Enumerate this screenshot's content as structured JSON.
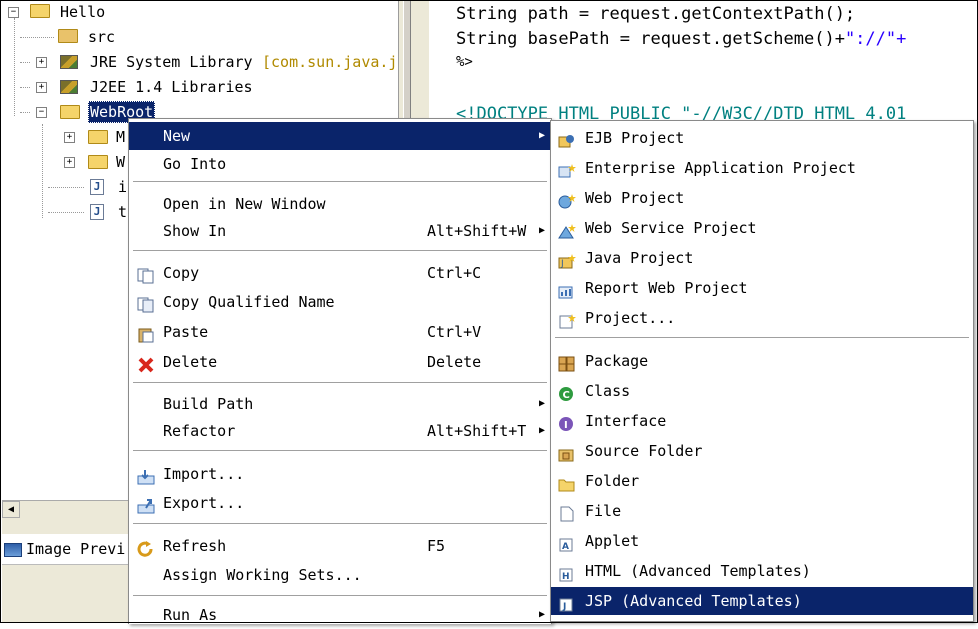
{
  "tree": {
    "project": "Hello",
    "items": [
      {
        "label": "src"
      },
      {
        "label": "JRE System Library",
        "suffix": "[com.sun.java.jd"
      },
      {
        "label": "J2EE 1.4 Libraries"
      },
      {
        "label": "WebRoot"
      },
      {
        "label": "M"
      },
      {
        "label": "W"
      },
      {
        "label": "i"
      },
      {
        "label": "t"
      }
    ]
  },
  "image_preview_tab": "Image Previ",
  "editor": {
    "lines": [
      {
        "text": "String path = request.getContextPath();"
      },
      {
        "text_a": "String basePath = request.getScheme()+",
        "text_b": "\"://\"+"
      },
      {
        "text": "%>"
      },
      {
        "text": "<!DOCTYPE HTML PUBLIC \"-//W3C//DTD HTML 4.01"
      }
    ]
  },
  "context_menu": {
    "items": [
      {
        "label": "New",
        "arrow": "▶",
        "selected": true
      },
      {
        "label": "Go Into"
      },
      {
        "label": "Open in New Window"
      },
      {
        "label": "Show In",
        "accel": "Alt+Shift+W",
        "arrow": "▶"
      },
      {
        "label": "Copy",
        "accel": "Ctrl+C",
        "icon": "copy-icon"
      },
      {
        "label": "Copy Qualified Name",
        "icon": "copy-qualified-name-icon"
      },
      {
        "label": "Paste",
        "accel": "Ctrl+V",
        "icon": "paste-icon"
      },
      {
        "label": "Delete",
        "accel": "Delete",
        "icon": "delete-icon",
        "icon_color": "#d8271c"
      },
      {
        "label": "Build Path",
        "arrow": "▶"
      },
      {
        "label": "Refactor",
        "accel": "Alt+Shift+T",
        "arrow": "▶"
      },
      {
        "label": "Import...",
        "icon": "import-icon"
      },
      {
        "label": "Export...",
        "icon": "export-icon"
      },
      {
        "label": "Refresh",
        "accel": "F5",
        "icon": "refresh-icon"
      },
      {
        "label": "Assign Working Sets..."
      },
      {
        "label": "Run As",
        "arrow": "▶"
      }
    ]
  },
  "submenu": {
    "items": [
      {
        "label": "EJB Project",
        "icon": "ejb-project-icon"
      },
      {
        "label": "Enterprise Application Project",
        "icon": "enterprise-application-project-icon"
      },
      {
        "label": "Web Project",
        "icon": "web-project-icon"
      },
      {
        "label": "Web Service Project",
        "icon": "web-service-project-icon"
      },
      {
        "label": "Java Project",
        "icon": "java-project-icon"
      },
      {
        "label": "Report Web Project",
        "icon": "report-web-project-icon"
      },
      {
        "label": "Project...",
        "icon": "project-icon"
      },
      {
        "label": "Package",
        "icon": "package-icon"
      },
      {
        "label": "Class",
        "icon": "class-icon",
        "icon_color": "#2e9b3f"
      },
      {
        "label": "Interface",
        "icon": "interface-icon",
        "icon_color": "#7b55b8"
      },
      {
        "label": "Source Folder",
        "icon": "source-folder-icon"
      },
      {
        "label": "Folder",
        "icon": "folder-icon"
      },
      {
        "label": "File",
        "icon": "file-icon"
      },
      {
        "label": "Applet",
        "icon": "applet-icon"
      },
      {
        "label": "HTML (Advanced Templates)",
        "icon": "html-icon"
      },
      {
        "label": "JSP (Advanced Templates)",
        "icon": "jsp-icon",
        "selected": true
      }
    ]
  },
  "colors": {
    "selection": "#0a246a",
    "string_literal": "#2a00ff",
    "jsp_tag": "#bf5f3f",
    "jre_suffix": "#b08a00"
  }
}
